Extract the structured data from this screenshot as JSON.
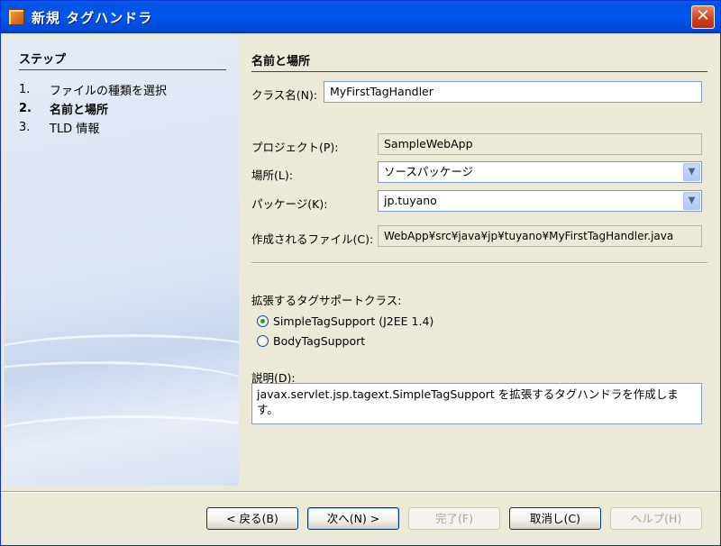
{
  "window": {
    "title": "新規 タグハンドラ",
    "close_glyph": "✕"
  },
  "steps": {
    "header": "ステップ",
    "items": [
      {
        "num": "1.",
        "label": "ファイルの種類を選択"
      },
      {
        "num": "2.",
        "label": "名前と場所"
      },
      {
        "num": "3.",
        "label": "TLD 情報"
      }
    ]
  },
  "panel": {
    "header": "名前と場所",
    "class_name": {
      "label": "クラス名(N):",
      "value": "MyFirstTagHandler"
    },
    "project": {
      "label": "プロジェクト(P):",
      "value": "SampleWebApp"
    },
    "location": {
      "label": "場所(L):",
      "value": "ソースパッケージ"
    },
    "package": {
      "label": "パッケージ(K):",
      "value": "jp.tuyano"
    },
    "created_file": {
      "label": "作成されるファイル(C):",
      "value": "WebApp¥src¥java¥jp¥tuyano¥MyFirstTagHandler.java"
    },
    "support_class": {
      "label": "拡張するタグサポートクラス:",
      "options": [
        {
          "label": "SimpleTagSupport (J2EE 1.4)",
          "checked": true
        },
        {
          "label": "BodyTagSupport",
          "checked": false
        }
      ]
    },
    "description": {
      "label": "説明(D):",
      "value": "javax.servlet.jsp.tagext.SimpleTagSupport を拡張するタグハンドラを作成します。"
    }
  },
  "buttons": {
    "back": "< 戻る(B)",
    "next": "次へ(N) >",
    "finish": "完了(F)",
    "cancel": "取消し(C)",
    "help": "ヘルプ(H)"
  },
  "icons": {
    "combo_arrow": "▼"
  }
}
